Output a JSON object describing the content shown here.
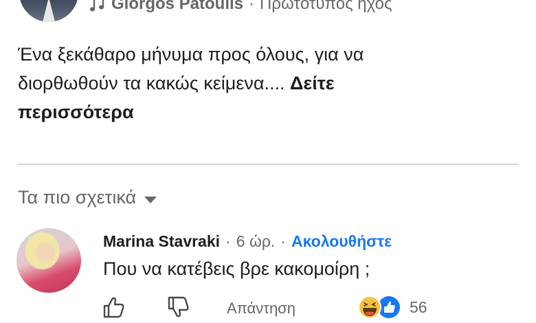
{
  "post": {
    "author": "Giorgos Patoulis",
    "audio_separator": "·",
    "audio_label": "Πρωτότυπος ήχος",
    "text": "Ένα ξεκάθαρο μήνυμα προς όλους, για να διορθωθούν τα κακώς κείμενα....",
    "see_more": "Δείτε περισσότερα"
  },
  "comments_section": {
    "sort_label": "Τα πιο σχετικά"
  },
  "comment": {
    "author": "Marina Stavraki",
    "separator": "·",
    "time": "6 ώρ.",
    "follow": "Ακολουθήστε",
    "text": "Που να κατέβεις βρε κακομοίρη ;",
    "reply_label": "Απάντηση",
    "reaction_count": "56",
    "reactions": [
      "haha",
      "like"
    ]
  },
  "colors": {
    "link_blue": "#1877f2",
    "secondary_text": "#65676b"
  },
  "icons": {
    "audio": "music-note-icon",
    "like": "thumbs-up-icon",
    "dislike": "thumbs-down-icon",
    "sort": "caret-down-icon"
  }
}
